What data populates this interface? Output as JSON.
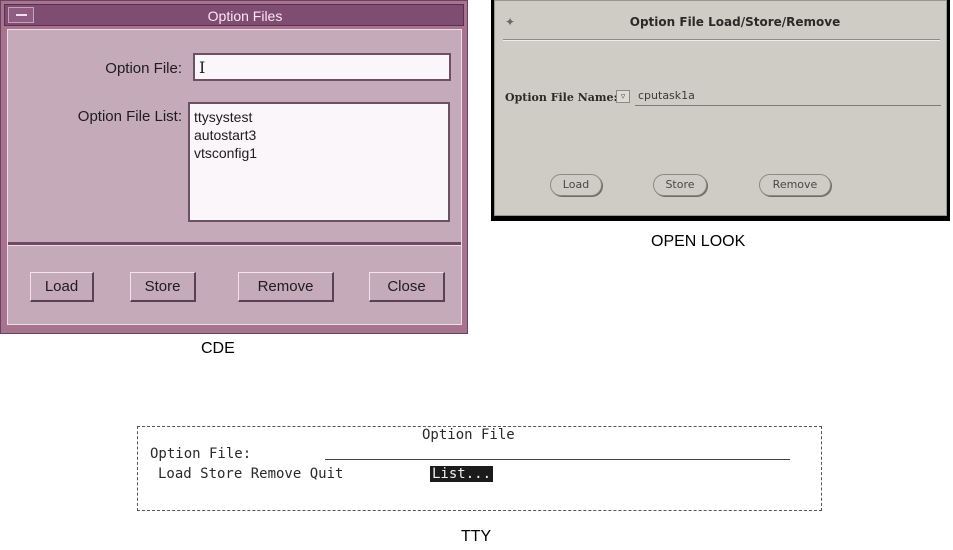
{
  "cde": {
    "title": "Option Files",
    "option_file_label": "Option File:",
    "option_file_value": "",
    "option_file_list_label": "Option File List:",
    "option_file_list": [
      "ttysystest",
      "autostart3",
      "vtsconfig1"
    ],
    "buttons": {
      "load": "Load",
      "store": "Store",
      "remove": "Remove",
      "close": "Close"
    },
    "caption": "CDE"
  },
  "openlook": {
    "title": "Option File Load/Store/Remove",
    "name_label": "Option File Name:",
    "name_value": "cputask1a",
    "buttons": {
      "load": "Load",
      "store": "Store",
      "remove": "Remove"
    },
    "caption": "OPEN LOOK"
  },
  "tty": {
    "title": "Option File",
    "option_file_label": "Option File:",
    "actions": "Load Store Remove Quit",
    "list_label": "List...",
    "caption": "TTY"
  }
}
